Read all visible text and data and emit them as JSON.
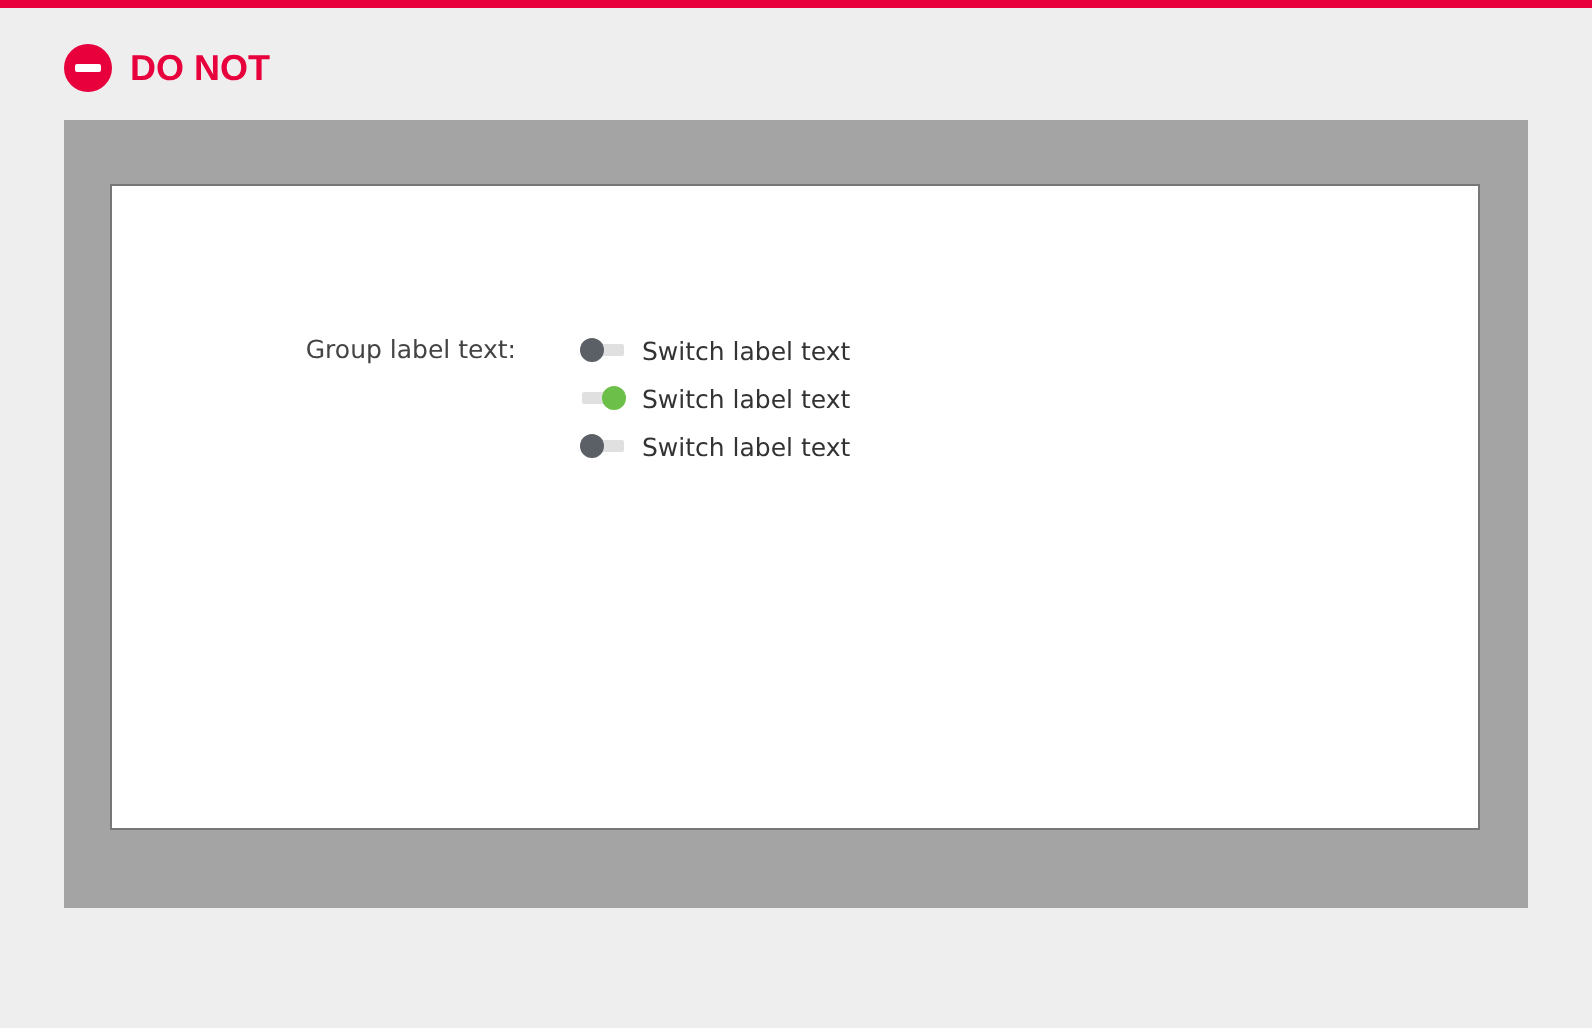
{
  "header": {
    "title": "DO NOT"
  },
  "group": {
    "label": "Group label text:",
    "switches": [
      {
        "label": "Switch label text",
        "on": false
      },
      {
        "label": "Switch label text",
        "on": true
      },
      {
        "label": "Switch label text",
        "on": false
      }
    ]
  }
}
